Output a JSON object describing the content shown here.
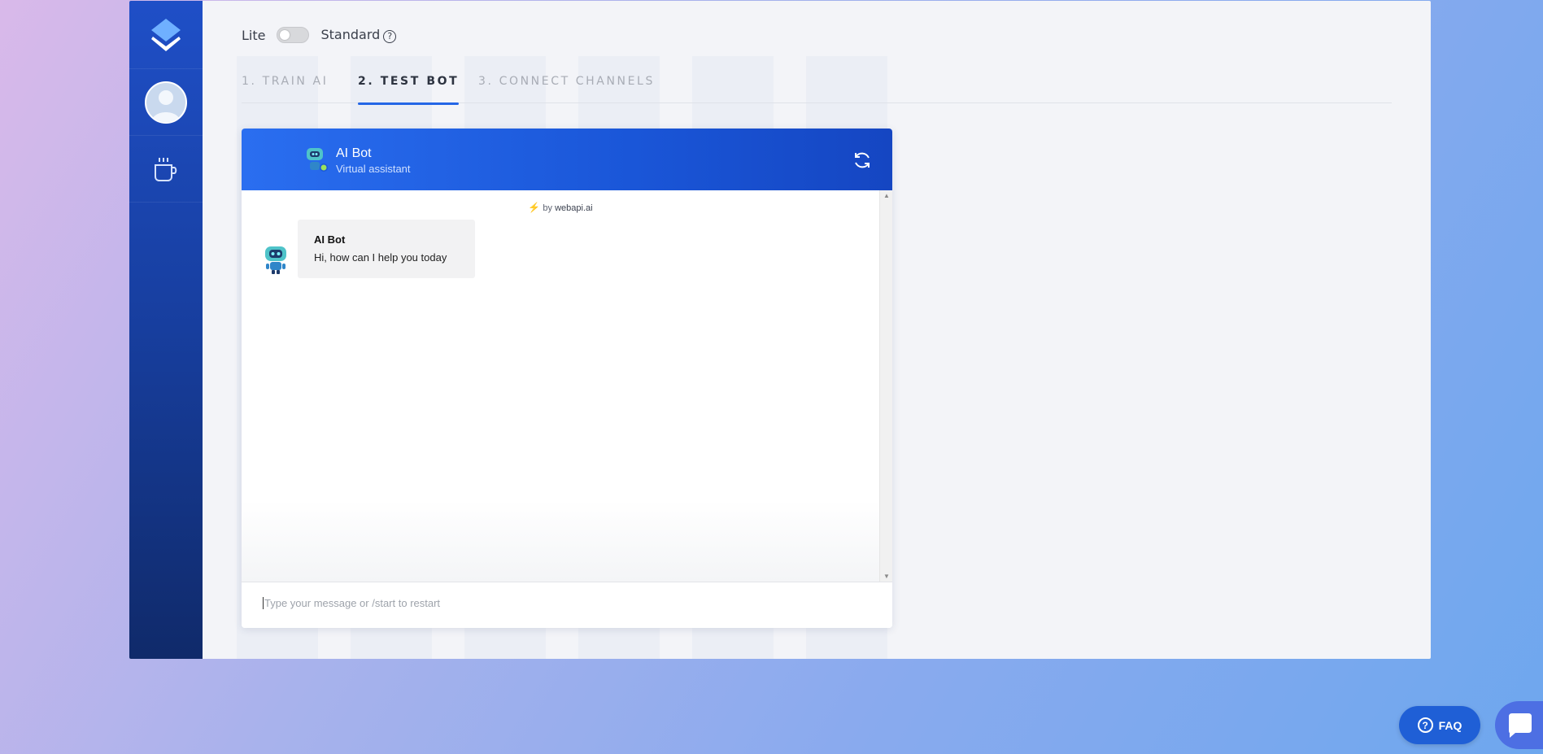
{
  "mode": {
    "lite_label": "Lite",
    "standard_label": "Standard",
    "help_glyph": "?",
    "toggle_state": "off"
  },
  "tabs": [
    {
      "label": "1. TRAIN AI"
    },
    {
      "label": "2. TEST BOT",
      "active": true
    },
    {
      "label": "3. CONNECT CHANNELS"
    }
  ],
  "chat": {
    "bot_name": "AI Bot",
    "bot_subtitle": "Virtual assistant",
    "powered_prefix": "by",
    "powered_brand": "webapi.ai",
    "messages": [
      {
        "sender": "AI Bot",
        "text": "Hi, how can I help you today"
      }
    ],
    "input_placeholder": "Type your message or /start to restart"
  },
  "footer": {
    "faq_label": "FAQ",
    "faq_glyph": "?"
  },
  "icons": {
    "logo": "layers-icon",
    "avatar": "user-avatar-icon",
    "coffee": "coffee-cup-icon",
    "refresh": "refresh-icon",
    "chat": "chat-bubble-icon"
  },
  "colors": {
    "sidebar": "#1a45b0",
    "header": "#1f5fe0",
    "accent": "#2466e6",
    "faq_button": "#1f5fd6"
  }
}
